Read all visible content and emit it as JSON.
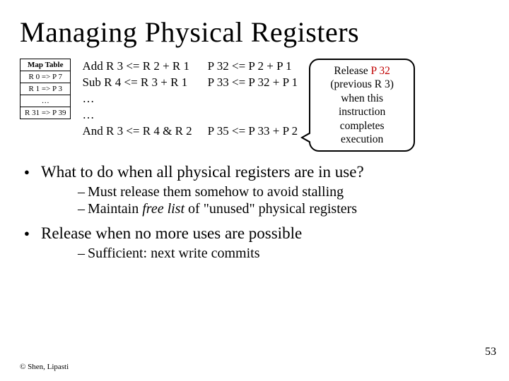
{
  "title": "Managing Physical Registers",
  "maptable": {
    "header": "Map Table",
    "rows": [
      "R 0 => P 7",
      "R 1 => P 3",
      "…",
      "R 31 => P 39"
    ]
  },
  "code": {
    "line1": "Add R 3 <= R 2 + R 1",
    "line2": "Sub R 4 <= R 3 + R 1",
    "line3": "…",
    "line4": "…",
    "line5": "And R 3 <= R 4 & R 2"
  },
  "renamed": {
    "line1": "P 32 <= P 2 + P 1",
    "line2": "P 33 <= P 32 + P 1",
    "line3": "",
    "line4": "",
    "line5": "P 35 <= P 33 + P 2"
  },
  "callout": {
    "l1a": "Release ",
    "l1b": "P 32",
    "l2": "(previous R 3)",
    "l3": "when this",
    "l4": "instruction",
    "l5": "completes",
    "l6": "execution"
  },
  "bullets": {
    "b1": "What to do when all physical registers are in use?",
    "b1s1": "Must release them somehow to avoid stalling",
    "b1s2a": "Maintain ",
    "b1s2b": "free list",
    "b1s2c": " of \"unused\" physical registers",
    "b2": "Release when no more uses are possible",
    "b2s1": "Sufficient: next write commits"
  },
  "footer": {
    "left": "© Shen, Lipasti",
    "right": "53"
  }
}
